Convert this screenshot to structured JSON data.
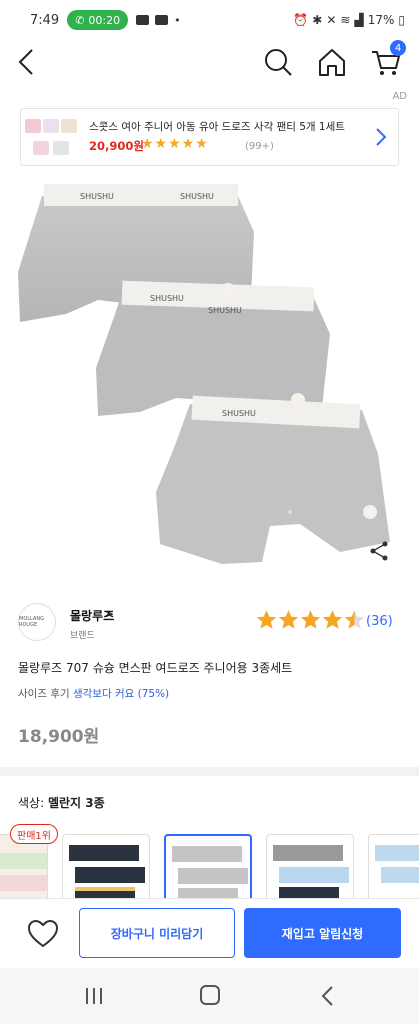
{
  "status_bar": {
    "time": "7:49",
    "call_timer": "00:20",
    "battery": "17%"
  },
  "header": {
    "cart_count": "4"
  },
  "ad": {
    "label": "AD",
    "title": "스콧스 여아 주니어 아동 유아 드로즈 사각 팬티 5개 1세트",
    "price": "20,900원",
    "stars": "★★★★★",
    "reviews": "(99+)"
  },
  "product": {
    "brand_name": "몰랑루즈",
    "brand_chevron": ">",
    "brand_sub": "브랜드",
    "brand_logo_text": "MOLLANG ROUGE",
    "rating": 4.5,
    "review_count": "(36)",
    "title": "몰랑루즈 707 슈슝 면스판 여드로즈 주니어용 3종세트",
    "size_review_label": "사이즈 후기",
    "size_review_value": "생각보다 커요 (75%)",
    "price": "18,900원"
  },
  "options": {
    "color_label": "색상:",
    "color_value": "멜란지 3종",
    "rank_badge": "판매1위"
  },
  "actions": {
    "add_to_cart": "장바구니 미리담기",
    "restock_alert": "재입고 알림신청"
  },
  "colors": {
    "accent": "#2f6bff",
    "price_red": "#e0271c",
    "star": "#f5a623"
  }
}
